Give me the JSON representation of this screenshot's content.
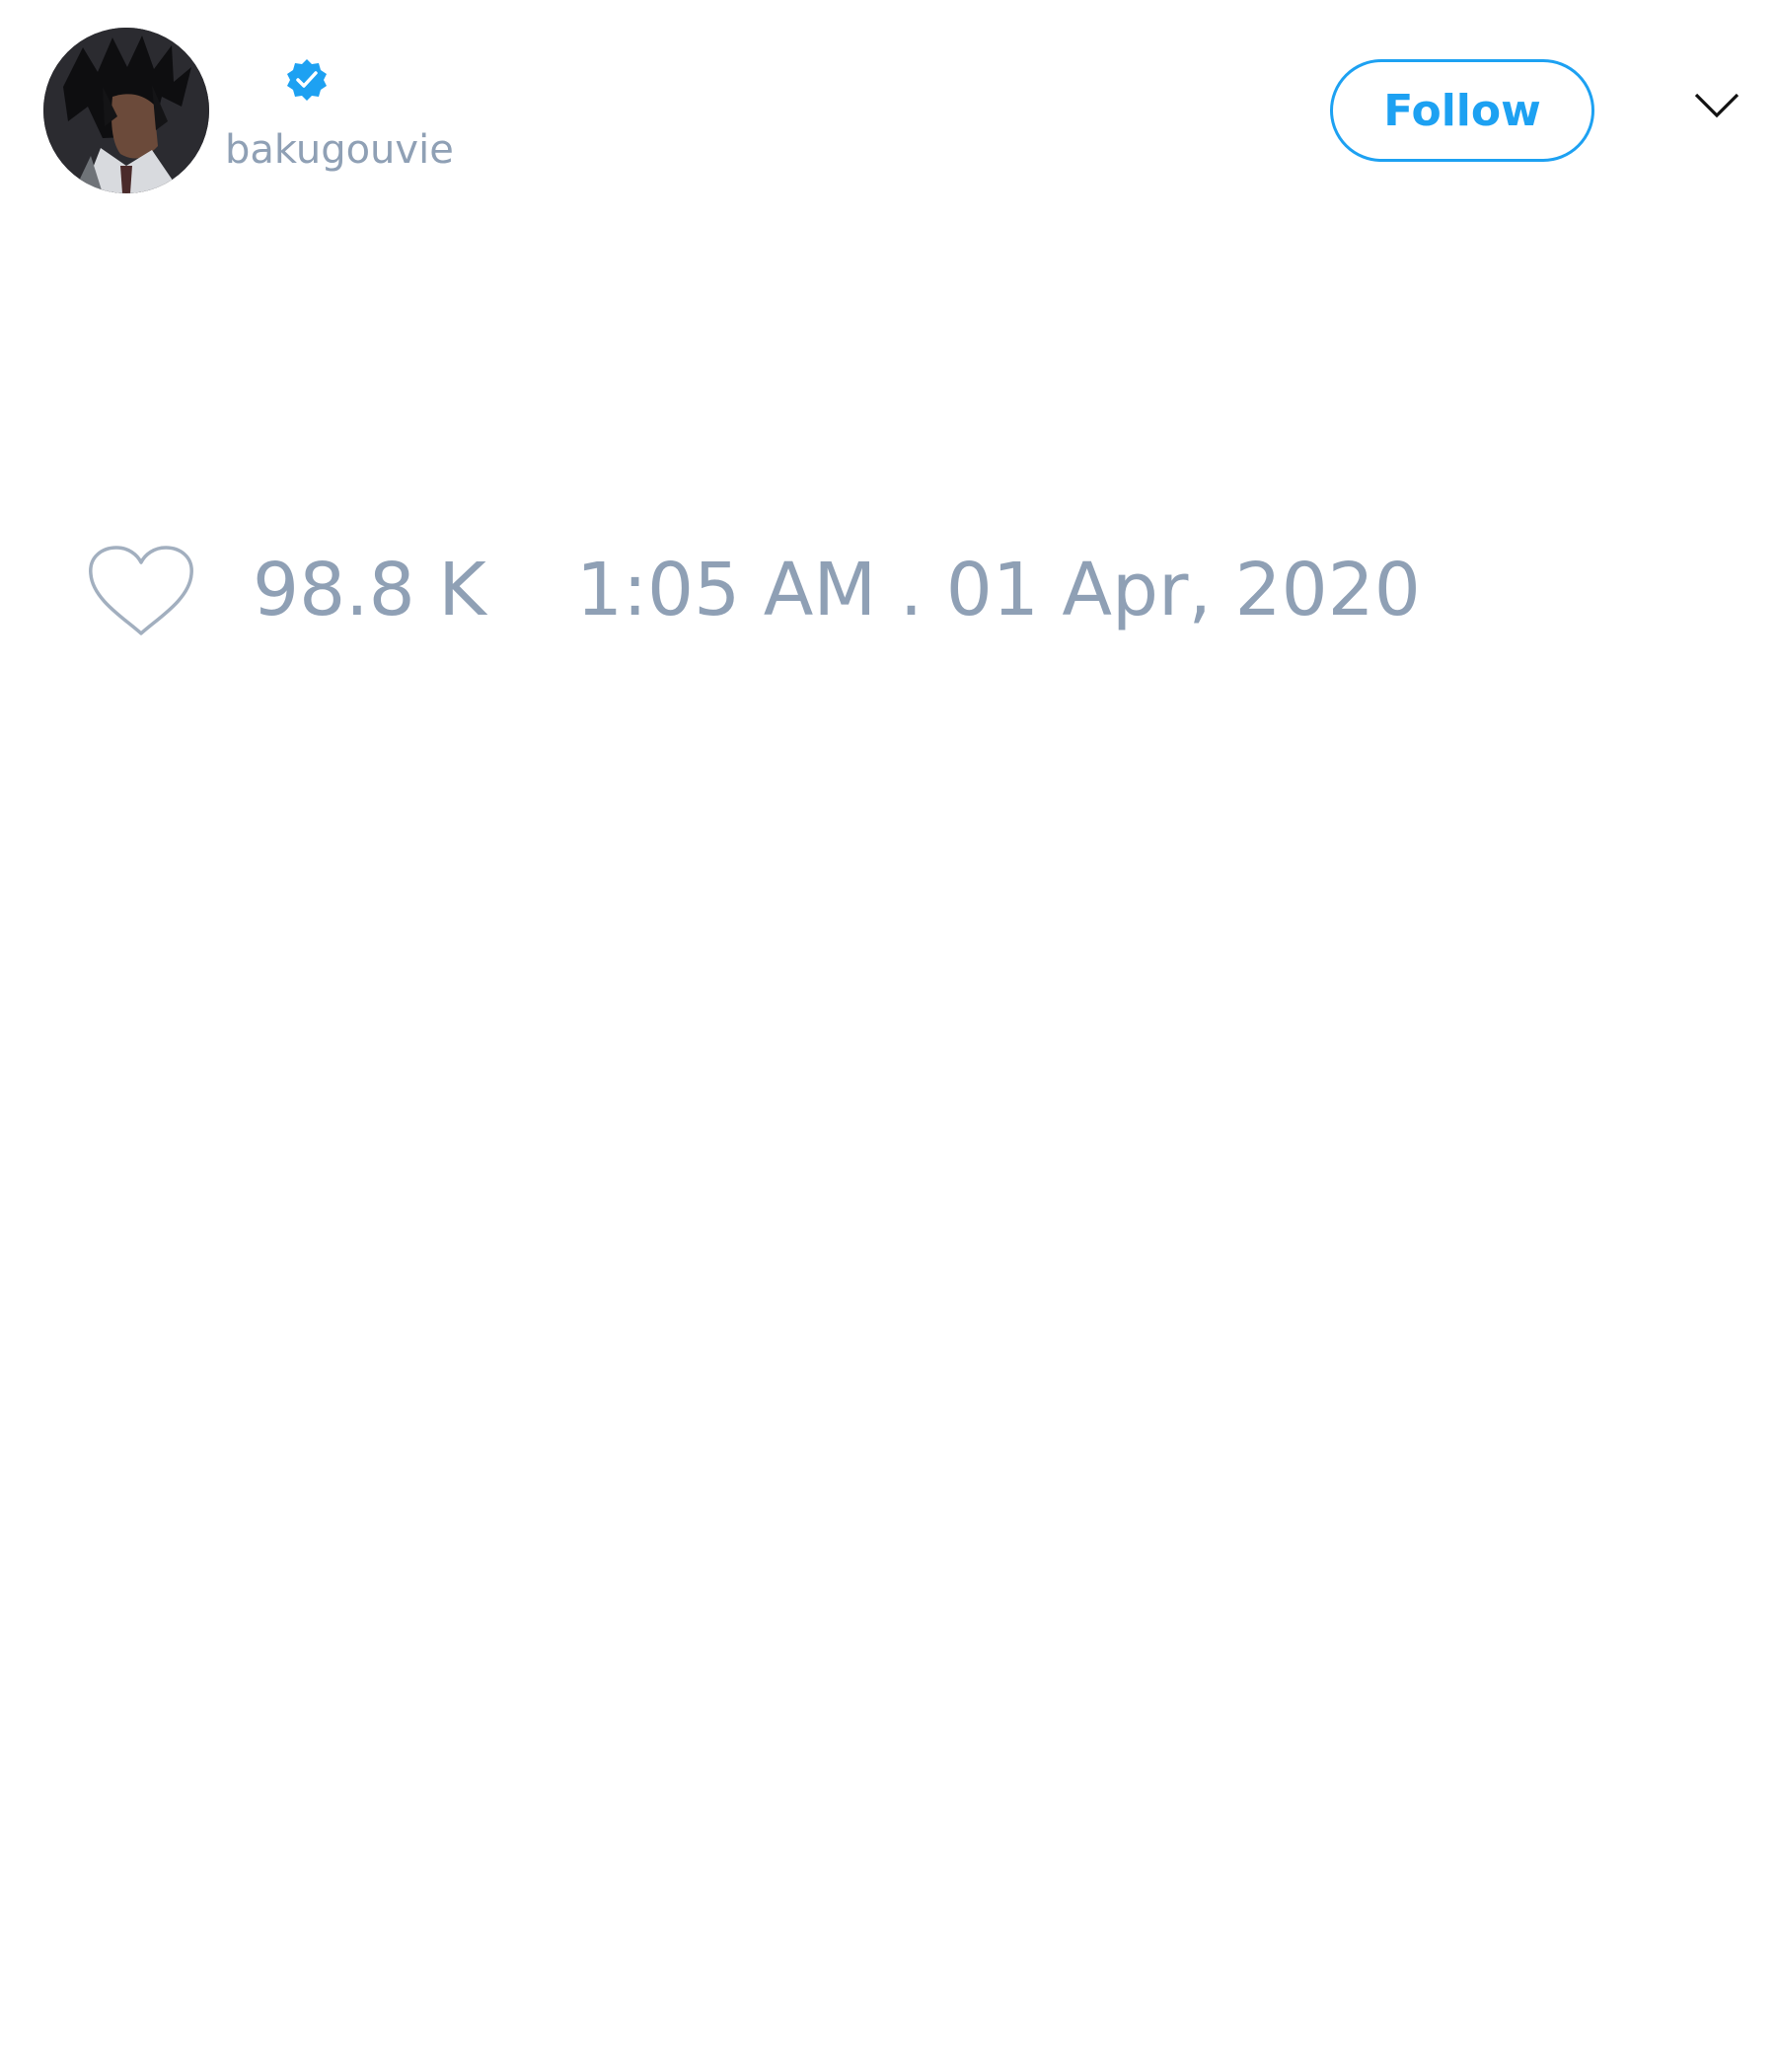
{
  "author": {
    "handle": "bakugouvie",
    "avatar": "anime-character-avatar",
    "verified_icon": "verified-badge-icon"
  },
  "header": {
    "follow_label": "Follow",
    "menu_icon": "chevron-down-icon"
  },
  "footer": {
    "like_icon": "heart-icon",
    "like_count": "98.8 K",
    "timestamp": "1:05 AM . 01 Apr, 2020"
  },
  "colors": {
    "accent": "#1da1f2",
    "muted_text": "#8fa0b5",
    "background": "#ffffff"
  }
}
